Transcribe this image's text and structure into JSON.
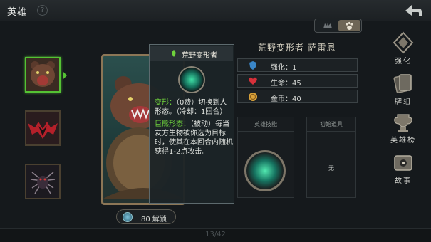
{
  "header": {
    "title": "英雄",
    "help": "?"
  },
  "view_toggle": {
    "options": [
      "team-icon",
      "paw-icon"
    ],
    "selected": 1
  },
  "hero_list": [
    {
      "name": "bear",
      "selected": true
    },
    {
      "name": "bat",
      "selected": false
    },
    {
      "name": "spider",
      "selected": false
    }
  ],
  "unlock": {
    "label": "80 解锁"
  },
  "tooltip": {
    "title": "荒野变形者",
    "transform_kw": "变形：",
    "transform_text": "（0费）切换到人形态。（冷却：1回合）",
    "passive_kw": "巨熊形态：",
    "passive_text": "（被动）每当友方生物被你选为目标时，使其在本回合内随机获得1-2点攻击。"
  },
  "hero_detail": {
    "name": "荒野变形者-萨雷恩",
    "stats": [
      {
        "icon": "shield-icon",
        "label": "强化：1",
        "color": "#3a86c8"
      },
      {
        "icon": "heart-icon",
        "label": "生命：45",
        "color": "#d6303a"
      },
      {
        "icon": "coin-icon",
        "label": "金币：40",
        "color": "#d9a23a"
      }
    ],
    "skill_header": "英雄技能",
    "item_header": "初始道具",
    "item_value": "无"
  },
  "nav": [
    {
      "label": "强化",
      "icon": "enhance-icon"
    },
    {
      "label": "牌组",
      "icon": "deck-icon"
    },
    {
      "label": "英雄榜",
      "icon": "ranking-icon"
    },
    {
      "label": "故事",
      "icon": "story-icon"
    }
  ],
  "pagination": {
    "text": "13/42"
  }
}
